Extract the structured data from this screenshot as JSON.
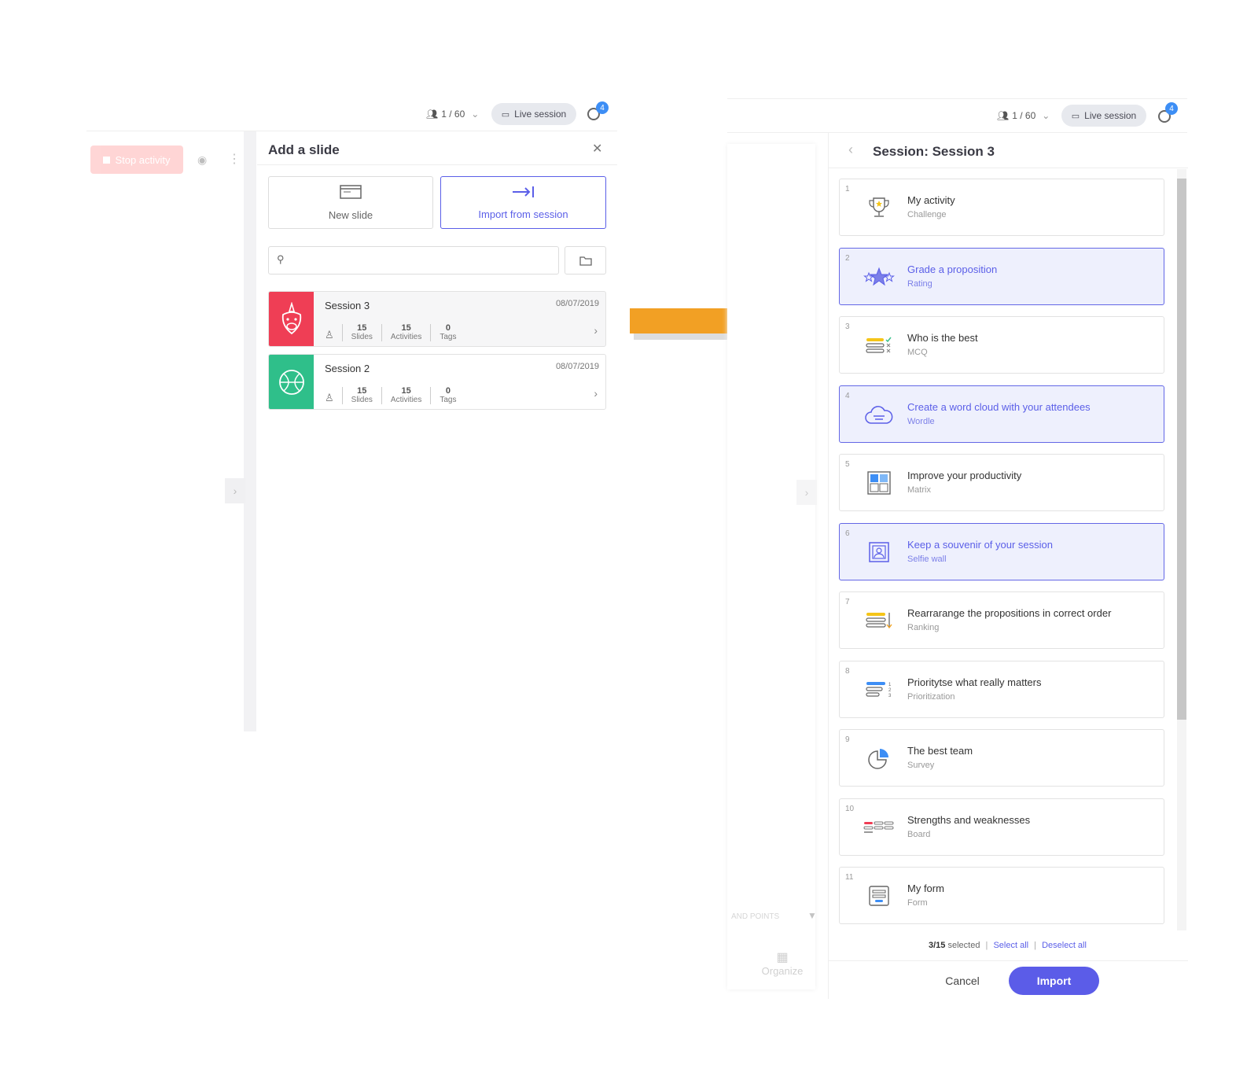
{
  "left": {
    "topbar": {
      "participants": "1 / 60",
      "live_session": "Live session",
      "notifications": "4"
    },
    "stop_activity": "Stop activity",
    "panel_title": "Add a slide",
    "new_slide": "New slide",
    "import_from_session": "Import from session",
    "search_placeholder": "",
    "sessions": [
      {
        "name": "Session 3",
        "date": "08/07/2019",
        "slides": "15",
        "slides_label": "Slides",
        "activities": "15",
        "activities_label": "Activities",
        "tags": "0",
        "tags_label": "Tags",
        "color": "#ef3e55"
      },
      {
        "name": "Session 2",
        "date": "08/07/2019",
        "slides": "15",
        "slides_label": "Slides",
        "activities": "15",
        "activities_label": "Activities",
        "tags": "0",
        "tags_label": "Tags",
        "color": "#2fbf8a"
      }
    ]
  },
  "arrow_color": "#f2a024",
  "right": {
    "topbar": {
      "participants": "1 / 60",
      "live_session": "Live session",
      "notifications": "4"
    },
    "panel_title": "Session: Session 3",
    "bg_labels": {
      "points": "AND POINTS",
      "organize": "Organize"
    },
    "items": [
      {
        "num": "1",
        "title": "My activity",
        "type": "Challenge",
        "icon": "trophy-icon"
      },
      {
        "num": "2",
        "title": "Grade a proposition",
        "type": "Rating",
        "icon": "stars-icon"
      },
      {
        "num": "3",
        "title": "Who is the best",
        "type": "MCQ",
        "icon": "mcq-icon"
      },
      {
        "num": "4",
        "title": "Create a word cloud with your attendees",
        "type": "Wordle",
        "icon": "cloud-icon"
      },
      {
        "num": "5",
        "title": "Improve your productivity",
        "type": "Matrix",
        "icon": "matrix-icon"
      },
      {
        "num": "6",
        "title": "Keep a souvenir of your session",
        "type": "Selfie wall",
        "icon": "selfie-icon"
      },
      {
        "num": "7",
        "title": "Rearrarange the propositions in correct order",
        "type": "Ranking",
        "icon": "ranking-icon"
      },
      {
        "num": "8",
        "title": "Prioritytse what really matters",
        "type": "Prioritization",
        "icon": "prioritization-icon"
      },
      {
        "num": "9",
        "title": "The best team",
        "type": "Survey",
        "icon": "pie-chart-icon"
      },
      {
        "num": "10",
        "title": "Strengths and weaknesses",
        "type": "Board",
        "icon": "board-icon"
      },
      {
        "num": "11",
        "title": "My form",
        "type": "Form",
        "icon": "form-icon"
      }
    ],
    "footer": {
      "selected_count": "3/15",
      "selected_word": "selected",
      "sep": "|",
      "select_all": "Select all",
      "deselect_all": "Deselect all",
      "cancel": "Cancel",
      "import": "Import"
    }
  },
  "colors": {
    "accent": "#5b5fe8",
    "accent_bg": "#eef0fd",
    "badge": "#3d8ef5"
  }
}
